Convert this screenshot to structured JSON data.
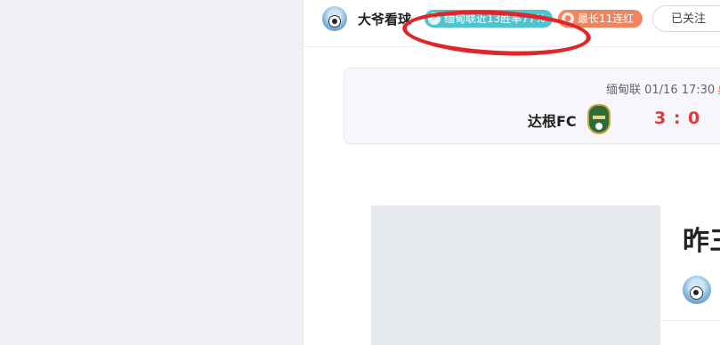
{
  "author": {
    "name": "大爷看球",
    "badges": [
      {
        "label": "缅甸联近13胜率77%",
        "icon": "trend-icon",
        "color": "#4fc3cf"
      },
      {
        "label": "最长11连红",
        "icon": "flame-icon",
        "color": "#f0845f"
      }
    ],
    "follow_label": "已关注"
  },
  "match": {
    "league_time": "缅甸联 01/16 17:30",
    "extra": "桌",
    "team": "达根FC",
    "score": "3 : 0"
  },
  "article": {
    "title": "昨三"
  },
  "colors": {
    "annotation": "#e0262a",
    "score": "#e0393e"
  }
}
